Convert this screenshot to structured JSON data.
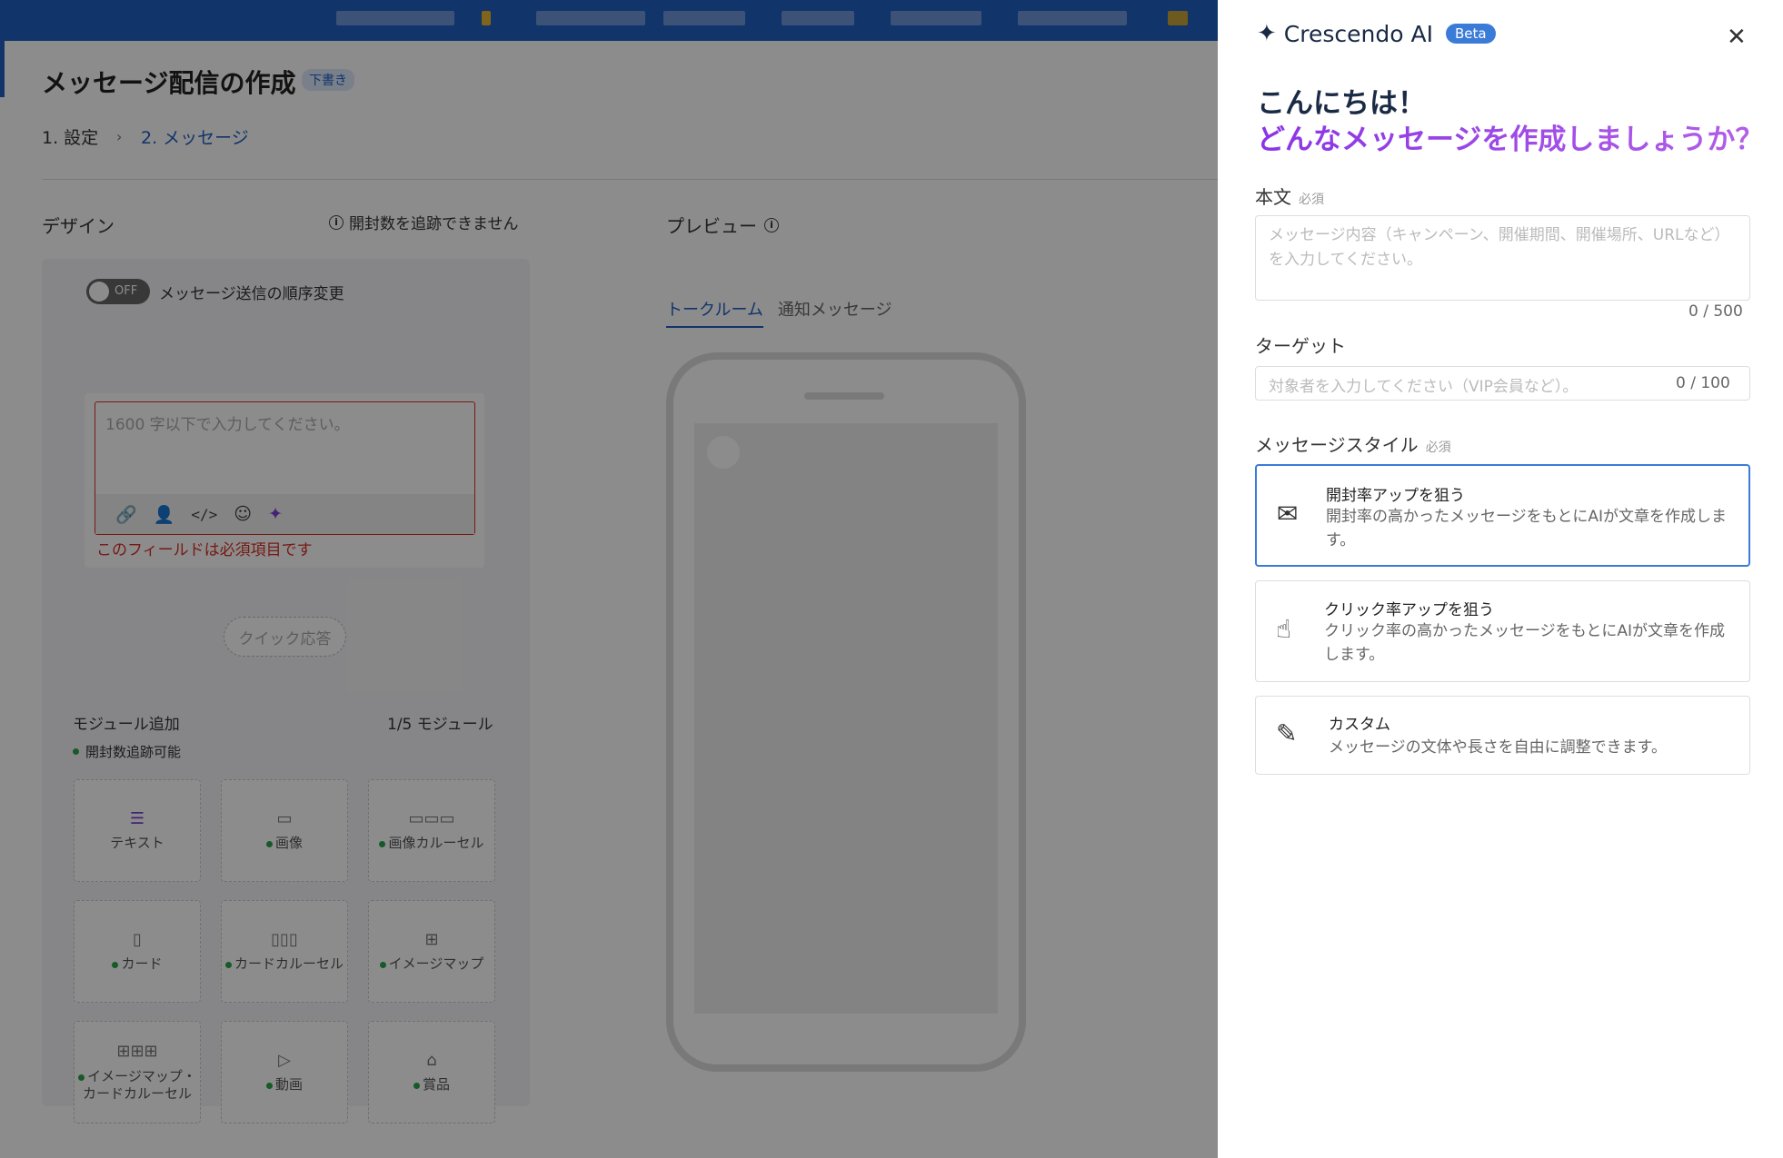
{
  "header": {
    "title": "メッセージ配信の作成",
    "badge": "下書き",
    "steps": [
      "1. 設定",
      "2. メッセージ"
    ],
    "step_sep": "›"
  },
  "design": {
    "label": "デザイン",
    "track_note": "開封数を追跡できません",
    "toggle_state": "OFF",
    "toggle_label": "メッセージ送信の順序変更",
    "editor_placeholder": "1600 字以下で入力してください。",
    "error": "このフィールドは必須項目です",
    "quick_reply": "クイック応答",
    "module_label": "モジュール追加",
    "module_count": "1/5 モジュール",
    "module_track": "開封数追跡可能",
    "modules": [
      {
        "label": "テキスト",
        "icon": "text-icon"
      },
      {
        "label": "画像",
        "icon": "image-icon"
      },
      {
        "label": "画像カルーセル",
        "icon": "image-carousel-icon"
      },
      {
        "label": "カード",
        "icon": "card-icon"
      },
      {
        "label": "カードカルーセル",
        "icon": "card-carousel-icon"
      },
      {
        "label": "イメージマップ",
        "icon": "imagemap-icon"
      },
      {
        "label": "イメージマップ・カードカルーセル",
        "icon": "imagemap-card-carousel-icon"
      },
      {
        "label": "動画",
        "icon": "video-icon"
      },
      {
        "label": "賞品",
        "icon": "gift-icon"
      }
    ]
  },
  "preview": {
    "label": "プレビュー",
    "tabs": [
      "トークルーム",
      "通知メッセージ"
    ]
  },
  "sidebar": {
    "title": "Crescendo AI",
    "badge": "Beta",
    "greeting1": "こんにちは！",
    "greeting2": "どんなメッセージを作成しましょうか？",
    "body_label": "本文",
    "body_required": "必須",
    "body_placeholder": "メッセージ内容（キャンペーン、開催期間、開催場所、URLなど）を入力してください。",
    "body_count": "0 / 500",
    "target_label": "ターゲット",
    "target_placeholder": "対象者を入力してください（VIP会員など）。",
    "target_count": "0 / 100",
    "style_label": "メッセージスタイル",
    "style_required": "必須",
    "styles": [
      {
        "title": "開封率アップを狙う",
        "desc": "開封率の高かったメッセージをもとにAIが文章を作成します。",
        "icon": "envelope-open-icon",
        "selected": true
      },
      {
        "title": "クリック率アップを狙う",
        "desc": "クリック率の高かったメッセージをもとにAIが文章を作成します。",
        "icon": "tap-icon",
        "selected": false
      },
      {
        "title": "カスタム",
        "desc": "メッセージの文体や長さを自由に調整できます。",
        "icon": "pencil-icon",
        "selected": false
      }
    ]
  },
  "colors": {
    "brand_blue": "#1f5fc4",
    "accent_purple": "#8a34e6",
    "error_red": "#d93025",
    "status_green": "#2aa34a"
  }
}
